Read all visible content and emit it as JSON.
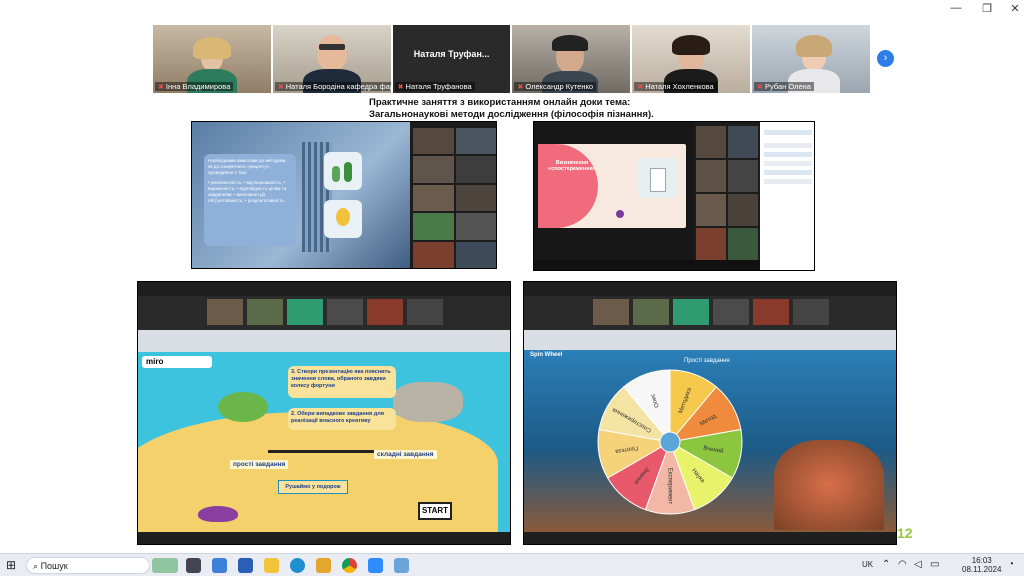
{
  "window": {
    "minimize": "—",
    "restore": "❐",
    "close": "✕"
  },
  "participants": [
    {
      "name": "Інна Владимирова",
      "muted": true
    },
    {
      "name": "Наталя Бородіна кафедра фарма...",
      "muted": true,
      "active": true
    },
    {
      "name": "Наталя Труфанова",
      "muted": true,
      "caption": "Наталя Труфан..."
    },
    {
      "name": "Олександр Кутенко",
      "muted": true
    },
    {
      "name": "Наталя Хохленкова",
      "muted": true
    },
    {
      "name": "Рубан Олена",
      "muted": true
    }
  ],
  "next_icon": "›",
  "slide": {
    "title1": "Практичне заняття з використанням онлайн доки тема:",
    "title2": "Загальнонаукові методи дослідження (філософія пізнання).",
    "page_number": "12",
    "shot1": {
      "text": "Необхідними вимогами до методики, як до конкретного «рецепту», проведення є такі:",
      "bullets": "• релевантність; • відтворюваність; • вираженість; • відповідність цілям та завданням; • виконання дії, обґрунтованість; • результативність."
    },
    "shot2": {
      "card_title": "Визначення «спостереження»"
    },
    "shot3": {
      "app": "miro",
      "step3": "3. Створи презентацію яка пояснить значення слова, обраного завдяки колесу фортуни",
      "step2": "2. Обери випадкове завдання для реалізації власного креативу",
      "simple": "прості завдання",
      "hard": "складні завдання",
      "treasure": "Рушаймо у подорож",
      "start": "START"
    },
    "shot4": {
      "app": "Spin Wheel",
      "top": "Прості завдання",
      "segments": [
        "Методика",
        "Метод",
        "Вчений",
        "Наука",
        "Експеримент",
        "Знання",
        "Гіпотеза",
        "Спостереження",
        "Опис"
      ]
    }
  },
  "taskbar": {
    "search": "Пошук",
    "lang": "UK",
    "time": "16:03",
    "date": "08.11.2024"
  },
  "colors": {
    "accent": "#2b7de9",
    "active": "#2ea043",
    "pageNum": "#92c83e"
  }
}
